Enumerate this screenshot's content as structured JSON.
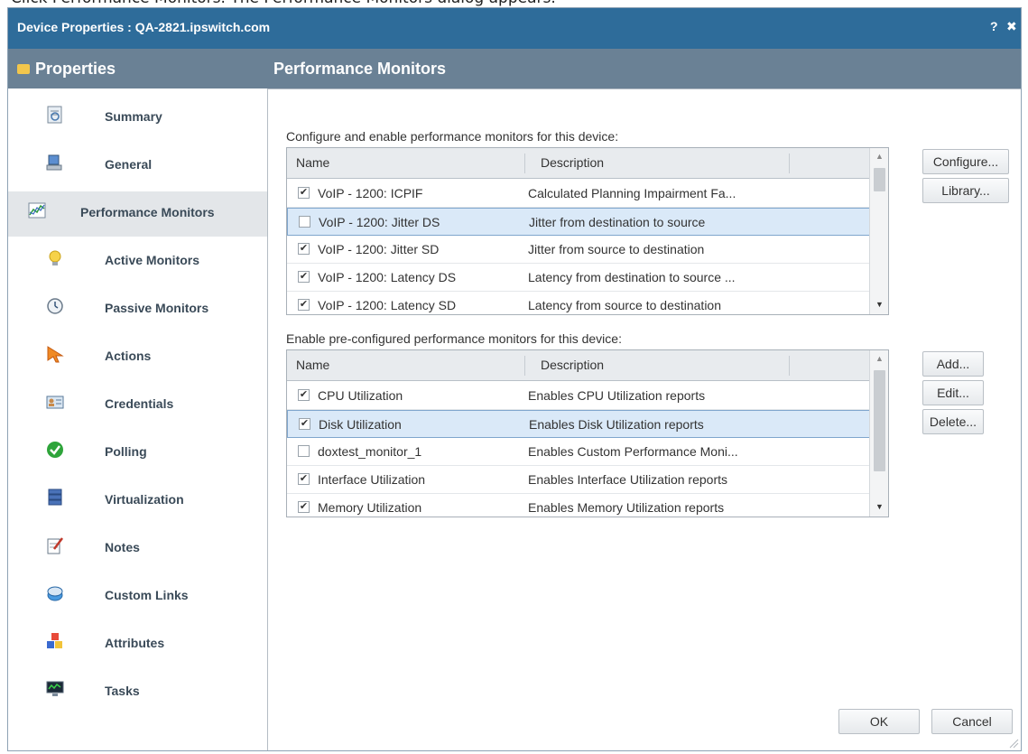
{
  "page_caption": "Click Performance Monitors. The Performance Monitors dialog appears.",
  "titlebar": {
    "title": "Device Properties : QA-2821.ipswitch.com",
    "help": "?",
    "close": "✖"
  },
  "header": {
    "left": "Properties",
    "right": "Performance Monitors"
  },
  "sidebar": {
    "items": [
      {
        "label": "Summary",
        "icon": "summary-icon",
        "selected": false
      },
      {
        "label": "General",
        "icon": "computer-icon",
        "selected": false
      },
      {
        "label": "Performance Monitors",
        "icon": "chart-icon",
        "selected": true
      },
      {
        "label": "Active Monitors",
        "icon": "lightbulb-icon",
        "selected": false
      },
      {
        "label": "Passive Monitors",
        "icon": "clock-icon",
        "selected": false
      },
      {
        "label": "Actions",
        "icon": "arrow-icon",
        "selected": false
      },
      {
        "label": "Credentials",
        "icon": "id-card-icon",
        "selected": false
      },
      {
        "label": "Polling",
        "icon": "checkmark-icon",
        "selected": false
      },
      {
        "label": "Virtualization",
        "icon": "server-stack-icon",
        "selected": false
      },
      {
        "label": "Notes",
        "icon": "notepad-icon",
        "selected": false
      },
      {
        "label": "Custom Links",
        "icon": "links-icon",
        "selected": false
      },
      {
        "label": "Attributes",
        "icon": "blocks-icon",
        "selected": false
      },
      {
        "label": "Tasks",
        "icon": "monitor-icon",
        "selected": false
      }
    ]
  },
  "section1": {
    "label": "Configure and enable performance monitors for this device:",
    "columns": [
      "Name",
      "Description"
    ],
    "rows": [
      {
        "checked": true,
        "name": "VoIP - 1200: ICPIF",
        "description": "Calculated Planning Impairment Fa...",
        "selected": false
      },
      {
        "checked": false,
        "name": "VoIP - 1200: Jitter DS",
        "description": "Jitter from destination to source",
        "selected": true
      },
      {
        "checked": true,
        "name": "VoIP - 1200: Jitter SD",
        "description": "Jitter from source to destination",
        "selected": false
      },
      {
        "checked": true,
        "name": "VoIP - 1200: Latency DS",
        "description": "Latency from destination to source ...",
        "selected": false
      },
      {
        "checked": true,
        "name": "VoIP - 1200: Latency SD",
        "description": "Latency from source to destination",
        "selected": false
      }
    ],
    "buttons": {
      "configure": "Configure...",
      "library": "Library..."
    }
  },
  "section2": {
    "label": "Enable pre-configured performance monitors for this device:",
    "columns": [
      "Name",
      "Description"
    ],
    "rows": [
      {
        "checked": true,
        "name": "CPU Utilization",
        "description": "Enables CPU Utilization reports",
        "selected": false
      },
      {
        "checked": true,
        "name": "Disk Utilization",
        "description": "Enables Disk Utilization reports",
        "selected": true
      },
      {
        "checked": false,
        "name": "doxtest_monitor_1",
        "description": "Enables Custom Performance Moni...",
        "selected": false
      },
      {
        "checked": true,
        "name": "Interface Utilization",
        "description": "Enables Interface Utilization reports",
        "selected": false
      },
      {
        "checked": true,
        "name": "Memory Utilization",
        "description": "Enables Memory Utilization reports",
        "selected": false
      }
    ],
    "buttons": {
      "add": "Add...",
      "edit": "Edit...",
      "delete": "Delete..."
    }
  },
  "footer": {
    "ok": "OK",
    "cancel": "Cancel"
  },
  "colors": {
    "titlebar": "#2e6c9a",
    "headerbar": "#6a8195",
    "selected_row": "#dae9f8",
    "selected_nav": "#e3e6e9"
  }
}
